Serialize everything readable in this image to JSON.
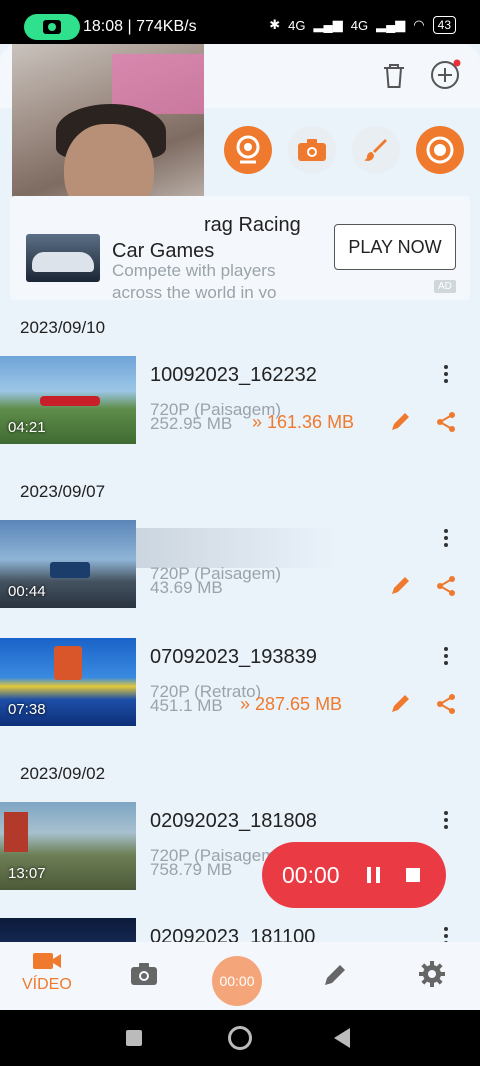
{
  "status_bar": {
    "time_speed": "18:08 | 774KB/s",
    "network_1": "4G",
    "network_2": "4G",
    "battery": "43"
  },
  "ad": {
    "title": "Drag Racing Car Games",
    "title_visible": "rag Racing",
    "title_line2": "Car Games",
    "description": "Compete with players across the world in yo",
    "cta": "PLAY NOW",
    "badge": "AD"
  },
  "sections": [
    {
      "date": "2023/09/10",
      "items": [
        {
          "name": "10092023_162232",
          "resolution": "720P (Paisagem)",
          "size": "252.95 MB",
          "compressed": "» 161.36 MB",
          "duration": "04:21"
        }
      ]
    },
    {
      "date": "2023/09/07",
      "items": [
        {
          "name": "",
          "resolution": "720P (Paisagem)",
          "size": "43.69 MB",
          "compressed": "",
          "duration": "00:44"
        },
        {
          "name": "07092023_193839",
          "resolution": "720P (Retrato)",
          "size": "451.1 MB",
          "compressed": "» 287.65 MB",
          "duration": "07:38"
        }
      ]
    },
    {
      "date": "2023/09/02",
      "items": [
        {
          "name": "02092023_181808",
          "resolution": "720P (Paisagem)",
          "size": "758.79 MB",
          "compressed": "",
          "duration": "13:07"
        },
        {
          "name": "02092023_181100",
          "resolution": "",
          "size": "",
          "compressed": "",
          "duration": ""
        }
      ]
    }
  ],
  "recording_control": {
    "time": "00:00"
  },
  "bottom_nav": {
    "video_label": "VÍDEO",
    "center_time": "00:00"
  },
  "colors": {
    "accent": "#ef7a2e",
    "record_red": "#ea3b45",
    "background": "#eaf2fa"
  }
}
